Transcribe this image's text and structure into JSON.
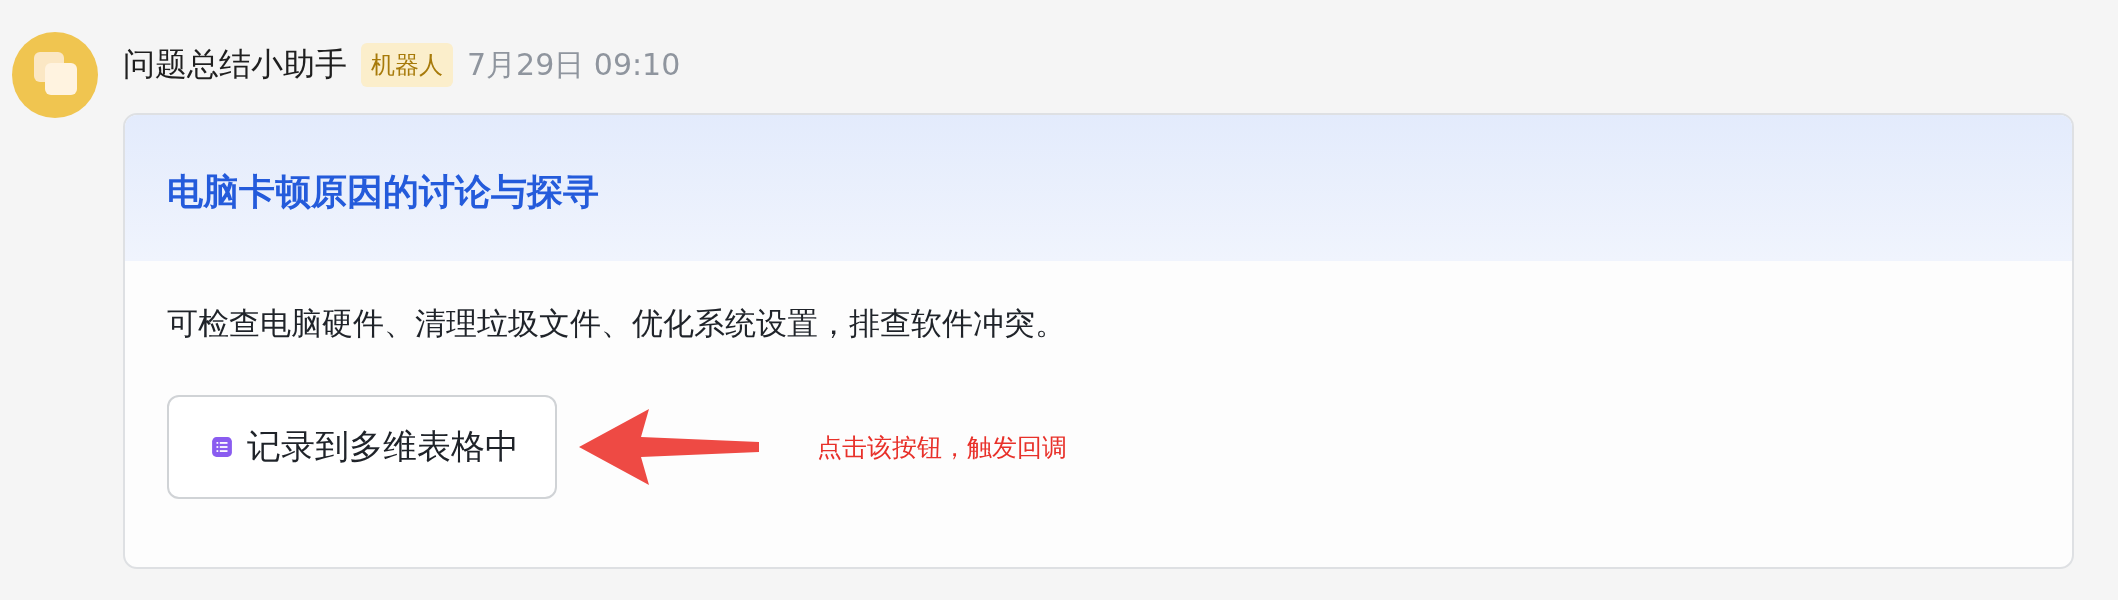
{
  "message": {
    "sender": "问题总结小助手",
    "badge": "机器人",
    "time": "7月29日 09:10"
  },
  "card": {
    "title": "电脑卡顿原因的讨论与探寻",
    "body": "可检查电脑硬件、清理垃圾文件、优化系统设置，排查软件冲突。",
    "button": "记录到多维表格中"
  },
  "annotation": {
    "text": "点击该按钮，触发回调"
  }
}
